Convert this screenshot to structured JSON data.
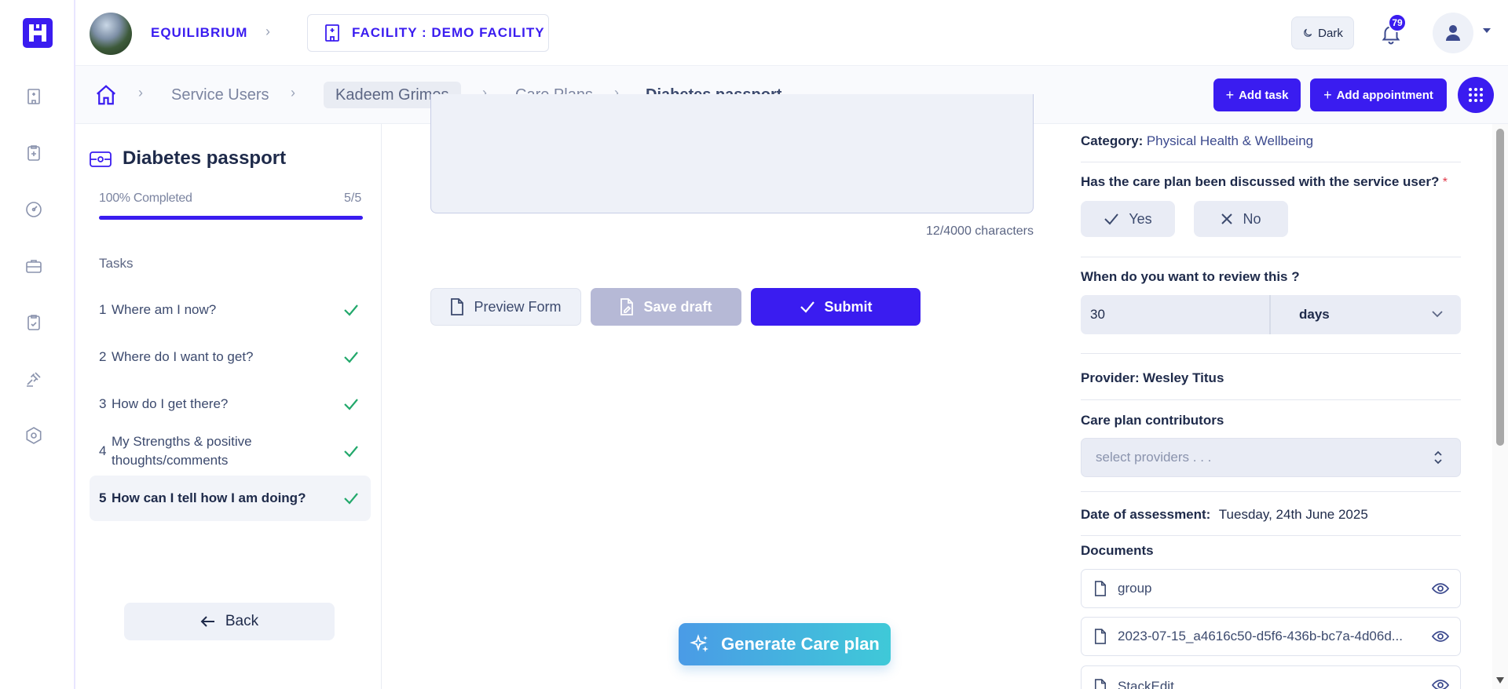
{
  "topbar": {
    "org_name": "EQUILIBRIUM",
    "facility_label": "FACILITY : DEMO FACILITY",
    "theme_label": "Dark",
    "notification_count": "79"
  },
  "breadcrumb": {
    "items": [
      "Service Users",
      "Kadeem Grimes",
      "Care Plans"
    ],
    "current": "Diabetes passport"
  },
  "actions": {
    "add_task": "Add task",
    "add_appointment": "Add appointment"
  },
  "task_panel": {
    "title": "Diabetes passport",
    "progress_label": "100% Completed",
    "progress_count": "5/5",
    "progress_fraction": 1.0,
    "tasks_heading": "Tasks",
    "tasks": [
      {
        "num": "1",
        "label": "Where am I now?",
        "done": true
      },
      {
        "num": "2",
        "label": "Where do I want to get?",
        "done": true
      },
      {
        "num": "3",
        "label": "How do I get there?",
        "done": true
      },
      {
        "num": "4",
        "label": "My Strengths & positive thoughts/comments",
        "done": true
      },
      {
        "num": "5",
        "label": "How can I tell how I am doing?",
        "done": true
      }
    ],
    "back_label": "Back"
  },
  "form": {
    "char_count": "12/4000 characters",
    "preview_label": "Preview Form",
    "save_draft_label": "Save draft",
    "submit_label": "Submit",
    "generate_label": "Generate Care plan"
  },
  "details": {
    "category_label": "Category:",
    "category_value": "Physical Health & Wellbeing",
    "discussed_question": "Has the care plan been discussed with the service user?",
    "required_mark": "*",
    "yes_label": "Yes",
    "no_label": "No",
    "review_question": "When do you want to review this ?",
    "review_value": "30",
    "review_unit": "days",
    "provider_label": "Provider:",
    "provider_value": "Wesley Titus",
    "contributors_label": "Care plan contributors",
    "contributors_placeholder": "select providers . . .",
    "assessment_label": "Date of assessment:",
    "assessment_value": "Tuesday, 24th June 2025",
    "documents_label": "Documents",
    "documents": [
      "group",
      "2023-07-15_a4616c50-d5f6-436b-bc7a-4d06d...",
      "StackEdit"
    ]
  },
  "colors": {
    "primary": "#3a1cf0",
    "success": "#22a86b",
    "generate_gradient_start": "#4a9be6",
    "generate_gradient_end": "#3fc9d8"
  }
}
